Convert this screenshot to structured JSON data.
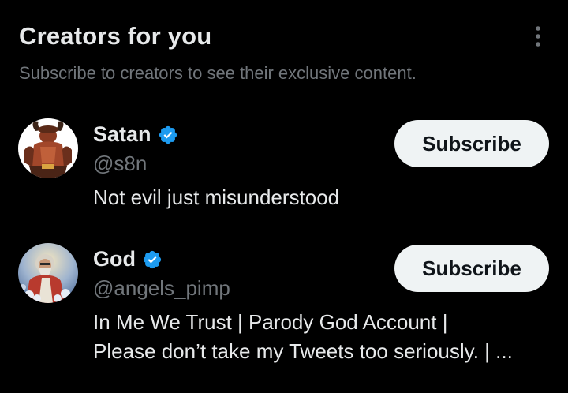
{
  "header": {
    "title": "Creators for you",
    "subtitle": "Subscribe to creators to see their exclusive content.",
    "more_icon": "vertical-ellipsis-icon"
  },
  "creators": [
    {
      "name": "Satan",
      "handle": "@s8n",
      "verified": true,
      "bio_lines": [
        "Not evil just misunderstood"
      ],
      "button_label": "Subscribe",
      "avatar": "devil-avatar"
    },
    {
      "name": "God",
      "handle": "@angels_pimp",
      "verified": true,
      "bio_lines": [
        "In Me We Trust | Parody God Account |",
        "Please don’t take my Tweets too seriously. | ..."
      ],
      "button_label": "Subscribe",
      "avatar": "god-avatar"
    }
  ],
  "colors": {
    "background": "#000000",
    "primary_text": "#e7e9ea",
    "secondary_text": "#71767b",
    "verified_blue": "#1d9bf0",
    "button_bg": "#eff3f4",
    "button_text": "#0f1419"
  }
}
